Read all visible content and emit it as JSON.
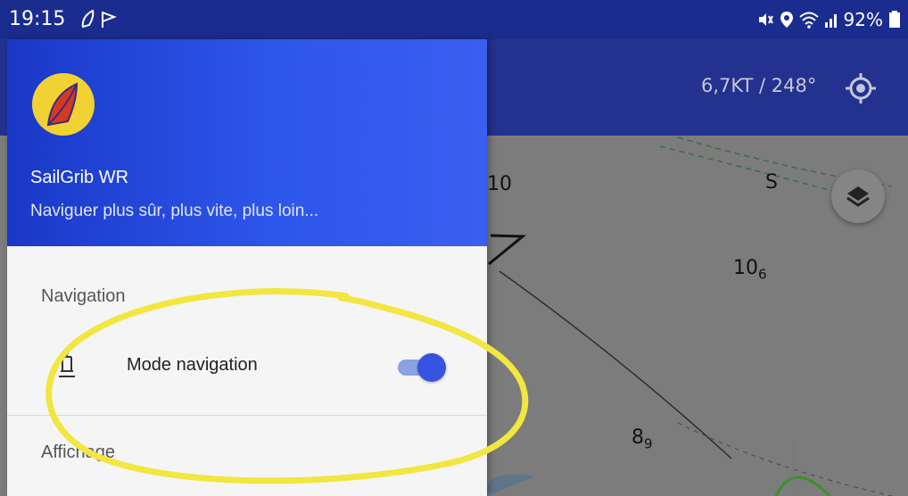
{
  "status_bar": {
    "time": "19:15",
    "battery": "92%"
  },
  "app_bar": {
    "speed_heading": "6,7KT / 248°"
  },
  "map": {
    "labels": [
      {
        "main": "10",
        "sub": ""
      },
      {
        "main": "S",
        "sub": ""
      },
      {
        "main": "10",
        "sub": "6"
      },
      {
        "main": "8",
        "sub": "9"
      }
    ]
  },
  "drawer": {
    "app_name": "SailGrib WR",
    "tagline": "Naviguer plus sûr, plus vite, plus loin...",
    "section_navigation": "Navigation",
    "nav_mode_label": "Mode navigation",
    "nav_mode_on": true,
    "section_display": "Affichage"
  },
  "colors": {
    "status_bar": "#1b2c8f",
    "app_bar": "#23328f",
    "drawer_header": "#2d56ea",
    "toggle_on": "#3553e0",
    "highlight": "#f2e640"
  }
}
